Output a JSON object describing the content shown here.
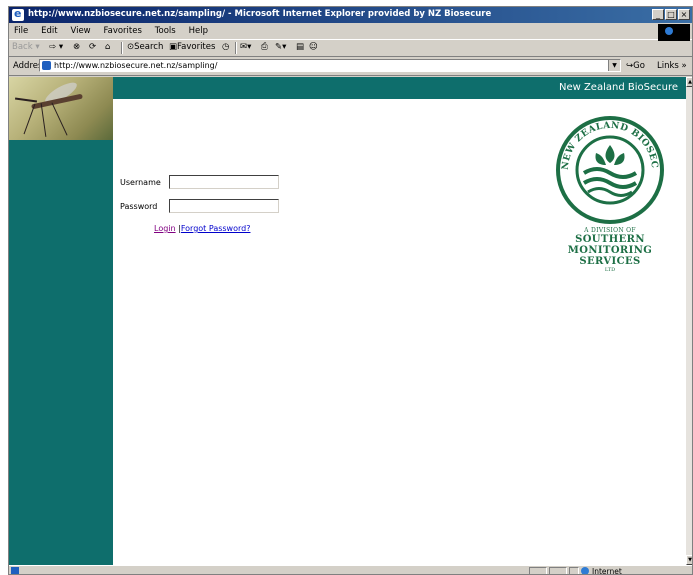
{
  "window": {
    "title": "http://www.nzbiosecure.net.nz/sampling/ - Microsoft Internet Explorer provided by NZ Biosecure",
    "controls": [
      "_",
      "□",
      "×"
    ]
  },
  "menu": [
    "File",
    "Edit",
    "View",
    "Favorites",
    "Tools",
    "Help"
  ],
  "toolbar": {
    "back_label": "Back",
    "search_label": "Search",
    "favorites_label": "Favorites"
  },
  "address_bar": {
    "label": "Address",
    "url": "http://www.nzbiosecure.net.nz/sampling/",
    "go_label": "Go",
    "links_label": "Links »"
  },
  "page": {
    "brand": "New Zealand BioSecure",
    "login": {
      "username_label": "Username",
      "password_label": "Password",
      "username_value": "",
      "password_value": "",
      "login_link": "Login",
      "separator": "|",
      "forgot_link": "Forgot Password?"
    },
    "logo": {
      "ring_text": "NEW ZEALAND BIOSECURE",
      "line1": "A DIVISION OF",
      "line2": "SOUTHERN",
      "line3": "MONITORING",
      "line4": "SERVICES",
      "line5": "LTD",
      "color": "#1d6f45"
    },
    "colors": {
      "teal": "#0e6e6c"
    }
  },
  "status_bar": {
    "zone": "Internet"
  }
}
